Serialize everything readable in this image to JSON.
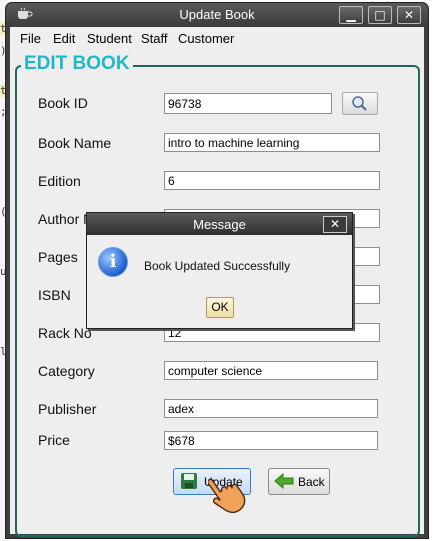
{
  "background_editor": {
    "fragments": [
      "te",
      ")",
      "te",
      ";",
      "(",
      "u",
      "l"
    ]
  },
  "window": {
    "title": "Update Book",
    "controls": {
      "minimize": "▁",
      "maximize": "□",
      "close": "✕"
    }
  },
  "menu": [
    "File",
    "Edit",
    "Student",
    "Staff",
    "Customer"
  ],
  "form": {
    "heading": "EDIT BOOK",
    "fields": [
      {
        "label": "Book ID",
        "value": "96738"
      },
      {
        "label": "Book Name",
        "value": "intro to machine learning"
      },
      {
        "label": "Edition",
        "value": "6"
      },
      {
        "label": "Author N",
        "value": ""
      },
      {
        "label": "Pages",
        "value": ""
      },
      {
        "label": "ISBN",
        "value": ""
      },
      {
        "label": "Rack No",
        "value": "12"
      },
      {
        "label": "Category",
        "value": "computer science"
      },
      {
        "label": "Publisher",
        "value": "adex"
      },
      {
        "label": "Price",
        "value": "$678"
      }
    ],
    "update_label": "Update",
    "back_label": "Back"
  },
  "dialog": {
    "title": "Message",
    "message": "Book Updated Successfully",
    "ok_label": "OK",
    "close": "✕",
    "icon_glyph": "i"
  },
  "colors": {
    "heading": "#1fb8c8",
    "group_border": "#1e6b63",
    "titlebar": "#3f3f3f"
  },
  "icons": [
    "cup-icon",
    "search-icon",
    "save-icon",
    "back-arrow-icon",
    "info-icon",
    "hand-cursor-icon"
  ]
}
